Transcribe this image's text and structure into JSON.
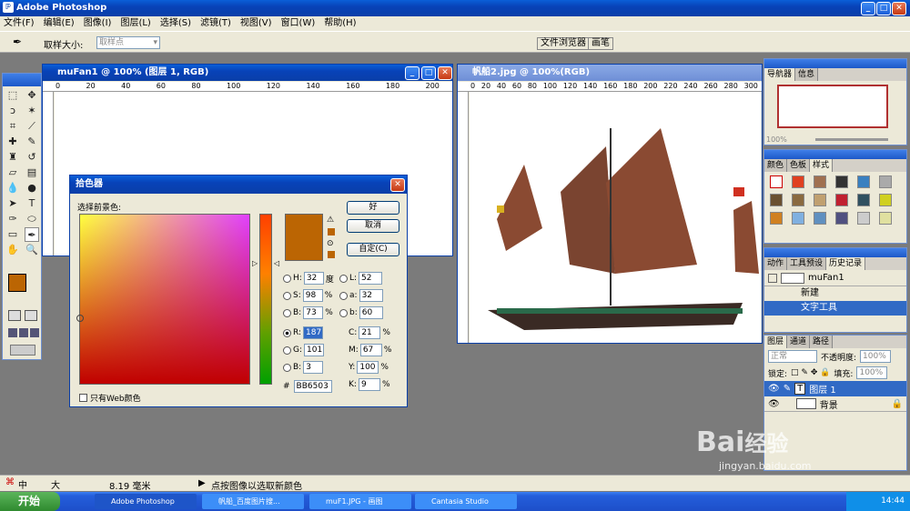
{
  "app": {
    "title": "Adobe Photoshop"
  },
  "menu": [
    "文件(F)",
    "编辑(E)",
    "图像(I)",
    "图层(L)",
    "选择(S)",
    "滤镜(T)",
    "视图(V)",
    "窗口(W)",
    "帮助(H)"
  ],
  "options": {
    "sample_size_label": "取样大小:",
    "sample_size_value": "取样点",
    "file_browser": "文件浏览器",
    "brushes": "画笔"
  },
  "doc1": {
    "title": "muFan1 @ 100% (图层 1, RGB)",
    "ruler": [
      "0",
      "20",
      "40",
      "60",
      "80",
      "100",
      "120",
      "140",
      "160",
      "180",
      "200"
    ]
  },
  "doc2": {
    "title": "帆船2.jpg @ 100%(RGB)",
    "ruler": [
      "0",
      "20",
      "40",
      "60",
      "80",
      "100",
      "120",
      "140",
      "160",
      "180",
      "200",
      "220",
      "240",
      "260",
      "280",
      "300"
    ]
  },
  "picker": {
    "title": "拾色器",
    "select_label": "选择前景色:",
    "ok": "好",
    "cancel": "取消",
    "custom": "自定(C)",
    "H": "32",
    "S": "98",
    "B": "73",
    "R": "187",
    "G": "101",
    "Bv": "3",
    "L": "52",
    "a": "32",
    "b": "60",
    "C": "21",
    "M": "67",
    "Y": "100",
    "K": "9",
    "hex": "BB6503",
    "web_only": "只有Web颜色",
    "deg": "度",
    "pct": "%",
    "lbl_H": "H:",
    "lbl_S": "S:",
    "lbl_B": "B:",
    "lbl_R": "R:",
    "lbl_G": "G:",
    "lbl_Bb": "B:",
    "lbl_L": "L:",
    "lbl_a": "a:",
    "lbl_b": "b:",
    "lbl_C": "C:",
    "lbl_M": "M:",
    "lbl_Y": "Y:",
    "lbl_K": "K:",
    "hash": "#",
    "color": "#BB6503"
  },
  "navigator": {
    "tabs": [
      "导航器",
      "信息"
    ],
    "zoom": "100%"
  },
  "swatches_panel": {
    "tabs": [
      "颜色",
      "色板",
      "样式"
    ]
  },
  "history": {
    "tabs": [
      "动作",
      "工具预设",
      "历史记录"
    ],
    "snapshot": "muFan1",
    "items": [
      "新建",
      "文字工具"
    ]
  },
  "layers": {
    "tabs": [
      "图层",
      "通道",
      "路径"
    ],
    "mode": "正常",
    "opacity_label": "不透明度:",
    "opacity": "100%",
    "lock_label": "锁定:",
    "fill_label": "填充:",
    "fill": "100%",
    "rows": [
      "图层 1",
      "背景"
    ]
  },
  "status": {
    "size": "8.19 毫米",
    "hint": "点按图像以选取新颜色",
    "ime": "中",
    "ime2": "大"
  },
  "taskbar": {
    "start": "开始",
    "items": [
      "Adobe Photoshop",
      "帆船_百度图片搜...",
      "muF1.JPG - 画图",
      "Cantasia Studio"
    ],
    "time": "14:44"
  },
  "watermark": {
    "brand": "Bai",
    "brand2": "经验",
    "url": "jingyan.baidu.com"
  }
}
